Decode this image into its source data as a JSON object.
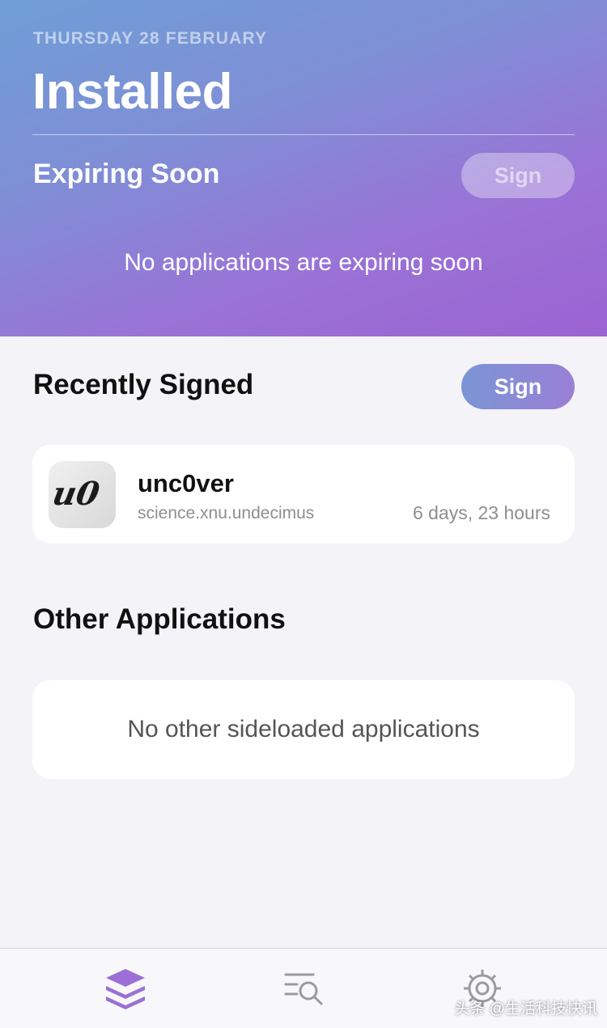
{
  "header": {
    "date": "THURSDAY 28 FEBRUARY",
    "title": "Installed"
  },
  "expiring_soon": {
    "title": "Expiring Soon",
    "button_label": "Sign",
    "empty_message": "No applications are expiring soon"
  },
  "recently_signed": {
    "title": "Recently Signed",
    "button_label": "Sign",
    "apps": [
      {
        "icon": "unc0ver-logo",
        "icon_text": "u0",
        "name": "unc0ver",
        "bundle_id": "science.xnu.undecimus",
        "expires_in": "6 days, 23 hours"
      }
    ]
  },
  "other_applications": {
    "title": "Other Applications",
    "empty_message": "No other sideloaded applications"
  },
  "tabbar": {
    "tabs": [
      {
        "icon": "stack-layers-icon",
        "active": true
      },
      {
        "icon": "browse-search-icon",
        "active": false
      },
      {
        "icon": "gear-icon",
        "active": false
      }
    ]
  },
  "watermark": "头条 @生活科技快讯",
  "colors": {
    "accent": "#9b6fd6",
    "header_gradient_start": "#6f9ed6",
    "header_gradient_end": "#9b63d2",
    "secondary_text": "#8e8e93",
    "tab_inactive": "#9a9aa0"
  }
}
